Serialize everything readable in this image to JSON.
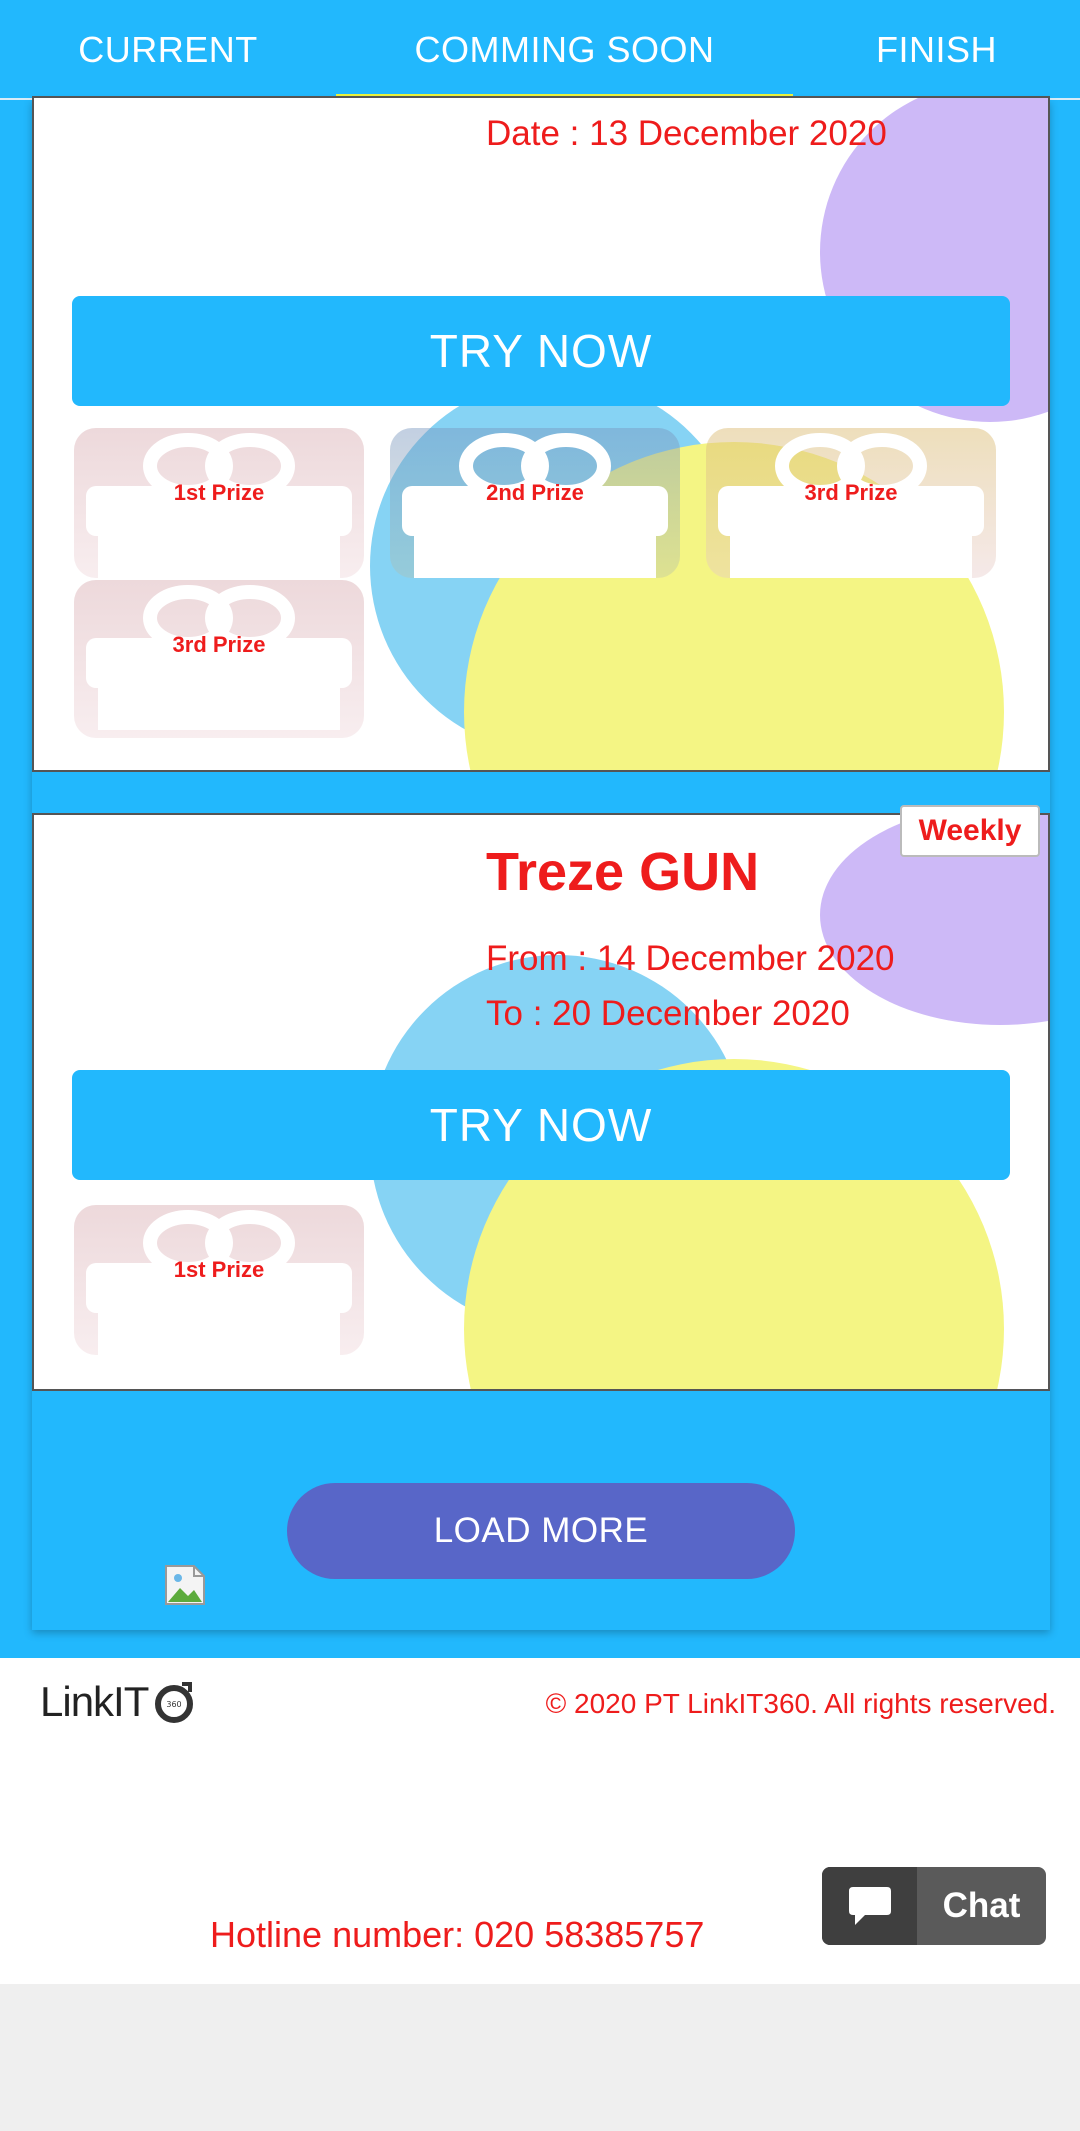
{
  "tabs": {
    "current": "CURRENT",
    "coming_soon": "COMMING SOON",
    "finish": "FINISH",
    "active": "COMMING SOON"
  },
  "card1": {
    "date": "Date : 13 December 2020",
    "try_label": "TRY NOW",
    "prizes": [
      "1st Prize",
      "2nd Prize",
      "3rd Prize",
      "3rd Prize"
    ]
  },
  "card2": {
    "badge": "Weekly",
    "title": "Treze GUN",
    "from": "From : 14 December 2020",
    "to": "To : 20 December 2020",
    "try_label": "TRY NOW",
    "prizes": [
      "1st Prize"
    ]
  },
  "load_more": "LOAD MORE",
  "footer": {
    "logo_text": "LinkIT",
    "logo_badge": "360",
    "copyright": "© 2020 PT LinkIT360. All rights reserved.",
    "hotline": "Hotline number: 020 58385757"
  },
  "chat": {
    "label": "Chat",
    "icon": "speech-bubble-icon"
  },
  "colors": {
    "primary_blue": "#22b8fd",
    "accent_red": "#ee1c1c",
    "tab_indicator": "#ecf23b",
    "load_more": "#5866c8",
    "chat_bg": "#5a5a5a"
  }
}
